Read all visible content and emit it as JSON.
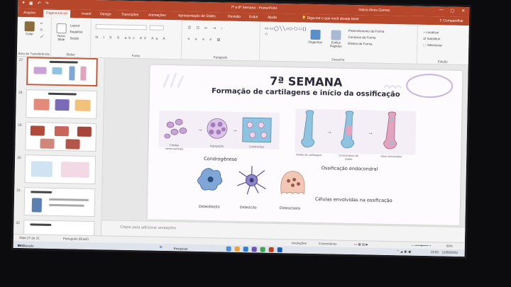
{
  "window": {
    "title": "7ª a 8ª Semana  -  PowerPoint",
    "user": "Inácio Alves Gomes",
    "share_label": "Compartilhar"
  },
  "tabs": [
    "Arquivo",
    "Página Inicial",
    "Inserir",
    "Design",
    "Transições",
    "Animações",
    "Apresentação de Slides",
    "Revisão",
    "Exibir",
    "Ajuda"
  ],
  "active_tab_index": 1,
  "search_hint": "Diga-me o que você deseja fazer",
  "ribbon": {
    "clipboard": {
      "paste": "Colar",
      "label": "Área de Transferência"
    },
    "slides": {
      "new_slide": "Novo Slide",
      "layout": "Layout",
      "reset": "Redefinir",
      "section": "Seção",
      "label": "Slides"
    },
    "font": {
      "label": "Fonte",
      "glyphs": "N I S S abc AV Aa A"
    },
    "paragraph": {
      "label": "Parágrafo"
    },
    "drawing": {
      "arrange": "Organizar",
      "quick_styles": "Estilos Rápidos",
      "fill": "Preenchimento da Forma",
      "outline": "Contorno da Forma",
      "effects": "Efeitos de Forma",
      "label": "Desenho",
      "shapes": "▭▭◯╲╲▱▷⬠⬭{}☆"
    },
    "editing": {
      "find": "Localizar",
      "replace": "Substituir",
      "select": "Selecionar",
      "label": "Edição"
    }
  },
  "thumbnails": [
    {
      "num": "27",
      "selected": true
    },
    {
      "num": "28",
      "selected": false
    },
    {
      "num": "29",
      "selected": false
    },
    {
      "num": "30",
      "selected": false
    },
    {
      "num": "31",
      "selected": false
    },
    {
      "num": "32",
      "selected": false
    }
  ],
  "slide": {
    "title": "7ª SEMANA",
    "subtitle": "Formação de cartilagens e início da ossificação",
    "cells_label": "Células mesenquimais",
    "aggregation_label": "Agregação",
    "chondrocytes_label": "Condrócitos",
    "chondrogenesis": "Condrogênese",
    "cartilage_model_label": "Molde de cartilagem",
    "mold_growth_label": "Crescimento do molde",
    "secondary_bone_label": "Osso secundário",
    "endochondral": "Ossificação endocondral",
    "osteoblast": "Osteoblasto",
    "osteocyte": "Osteócito",
    "osteoclast": "Osteoclasto",
    "cells_involved": "Células envolvidas na ossificação"
  },
  "notes_placeholder": "Clique para adicionar anotações",
  "status": {
    "slide_count": "Slide 27 de 31",
    "language": "Português (Brasil)",
    "notes": "Anotações",
    "comments": "Comentários",
    "zoom": "69%"
  },
  "taskbar": {
    "weather_temp": "28°C",
    "weather_desc": "Ensolarado",
    "search": "Pesquisar",
    "clock_time": "19:03",
    "clock_date": "11/09/2023"
  },
  "colors": {
    "accent": "#b7472a",
    "cell_purple": "#c9a3d6",
    "chondro_blue": "#8fc3e0",
    "bone_pink": "#e2a3bd",
    "osteo_blue": "#7fa6d6"
  }
}
